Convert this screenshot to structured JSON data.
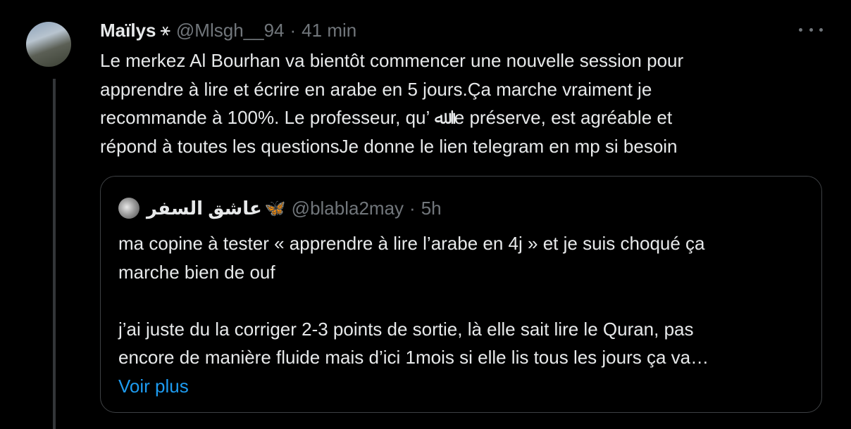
{
  "tweet": {
    "author_name": "Maïlys",
    "author_badge": "⚹",
    "handle": "@Mlsgh__94",
    "separator": "·",
    "time": "41 min",
    "avatar_icon": "avatar-photo",
    "text_lines": [
      "Le merkez Al Bourhan va bientôt commencer une nouvelle session pour",
      "apprendre à lire et écrire en arabe en 5 jours.Ça marche vraiment je",
      "recommande à 100%. Le professeur, qu’ ﷲ le préserve, est agréable et",
      "répond à toutes les questionsJe donne le lien telegram en mp si besoin"
    ]
  },
  "quote": {
    "author_name": "عاشق السفر",
    "author_badge": "🦋",
    "handle": "@blabla2may",
    "separator": "·",
    "time": "5h",
    "text_lines": [
      "ma copine à tester « apprendre à lire l’arabe en 4j » et je suis choqué ça",
      "marche bien de ouf",
      "",
      "j’ai juste du la corriger 2-3 points de sortie, là elle sait lire le Quran, pas",
      "encore de manière fluide mais d’ici 1mois si elle lis tous les jours ça va…"
    ],
    "show_more": "Voir plus"
  },
  "colors": {
    "background": "#000000",
    "text": "#e7e9ea",
    "muted": "#71767b",
    "link": "#1d9bf0",
    "border": "#3e4144"
  }
}
